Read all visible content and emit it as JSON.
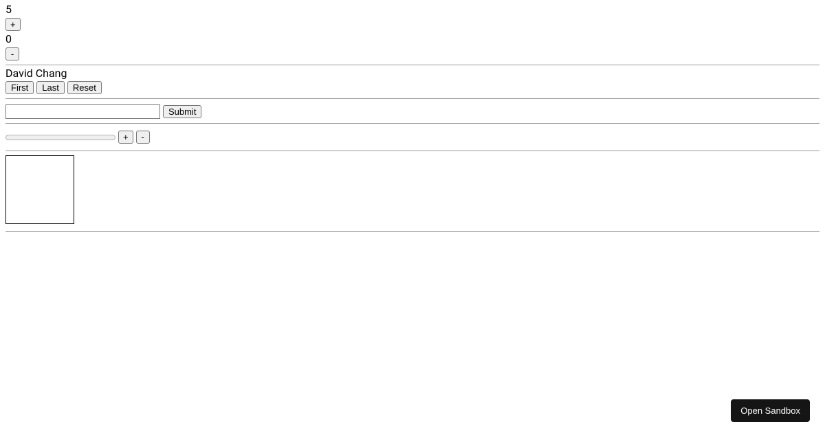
{
  "counter1": {
    "top_value": "5",
    "increment_label": "+",
    "bottom_value": "0",
    "decrement_label": "-"
  },
  "name_section": {
    "display_name": "David Chang",
    "first_button": "First",
    "last_button": "Last",
    "reset_button": "Reset"
  },
  "form_section": {
    "input_value": "",
    "submit_label": "Submit"
  },
  "progress_section": {
    "value": 0,
    "max": 100,
    "increment_label": "+",
    "decrement_label": "-"
  },
  "box_section": {},
  "sandbox": {
    "label": "Open Sandbox"
  }
}
